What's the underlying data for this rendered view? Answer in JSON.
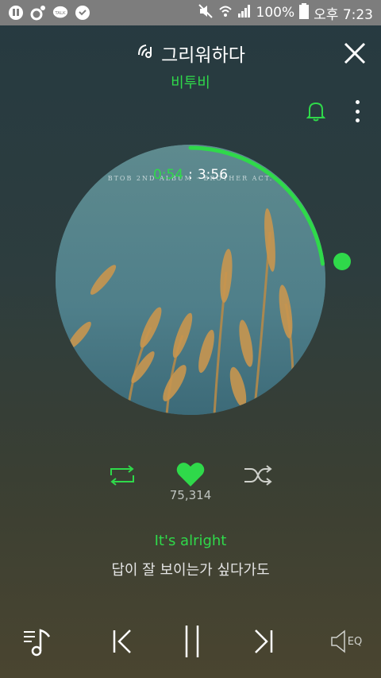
{
  "status_bar": {
    "battery": "100%",
    "time": "오후 7:23",
    "talk_label": "TALK"
  },
  "player": {
    "title": "그리워하다",
    "artist": "비투비",
    "album_text": "BTOB 2ND ALBUM · BROTHER ACT.",
    "current_time": "0:54",
    "separator": ":",
    "total_time": "3:56",
    "progress": 0.229,
    "likes": "75,314",
    "lyric_current": "It's alright",
    "lyric_next": "답이 잘 보이는가 싶다가도",
    "eq_label": "EQ"
  },
  "colors": {
    "accent": "#2fd94a",
    "status_bar": "#7d7d7d"
  },
  "icons": [
    "close-icon",
    "bell-icon",
    "more-vertical-icon",
    "repeat-icon",
    "heart-icon",
    "shuffle-icon",
    "playlist-icon",
    "previous-icon",
    "pause-icon",
    "next-icon",
    "eq-icon"
  ]
}
